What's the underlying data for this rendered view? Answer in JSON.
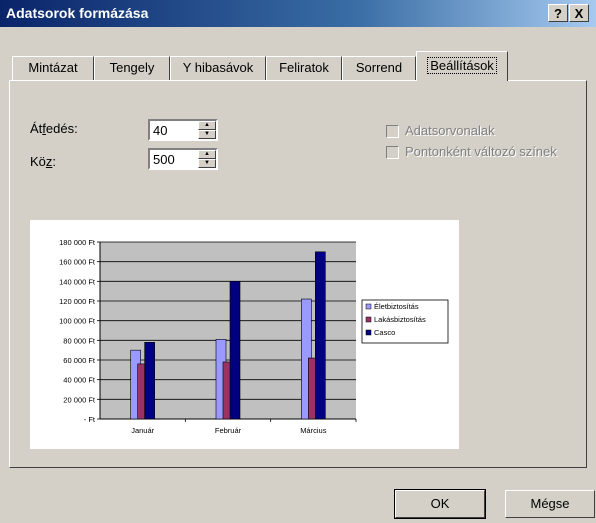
{
  "dialog": {
    "title": "Adatsorok formázása",
    "help_label": "?",
    "close_label": "X"
  },
  "tabs": [
    "Mintázat",
    "Tengely",
    "Y hibasávok",
    "Feliratok",
    "Sorrend",
    "Beállítások"
  ],
  "active_tab": "Beállítások",
  "options": {
    "overlap_label_pre": "Át",
    "overlap_label_u": "f",
    "overlap_label_post": "edés:",
    "overlap_value": "40",
    "gap_label_pre": "Kö",
    "gap_label_u": "z",
    "gap_label_post": ":",
    "gap_value": "500",
    "series_lines_label": "Adatsorvonalak",
    "vary_colors_label": "Pontonként változó színek"
  },
  "buttons": {
    "ok": "OK",
    "cancel": "Mégse"
  },
  "chart_data": {
    "type": "bar",
    "categories": [
      "Január",
      "Február",
      "Március"
    ],
    "series": [
      {
        "name": "Életbiztosítás",
        "color": "#9999ff",
        "values": [
          70000,
          81000,
          122000
        ]
      },
      {
        "name": "Lakásbiztosítás",
        "color": "#993366",
        "values": [
          56000,
          58000,
          62000
        ]
      },
      {
        "name": "Casco",
        "color": "#000080",
        "values": [
          78000,
          140000,
          170000
        ]
      }
    ],
    "ylim": [
      0,
      180000
    ],
    "ytick_labels": [
      "-   Ft",
      "20 000 Ft",
      "40 000 Ft",
      "60 000 Ft",
      "80 000 Ft",
      "100 000 Ft",
      "120 000 Ft",
      "140 000 Ft",
      "160 000 Ft",
      "180 000 Ft"
    ],
    "plot_background": "#c0c0c0",
    "grid": true,
    "legend_position": "right"
  }
}
